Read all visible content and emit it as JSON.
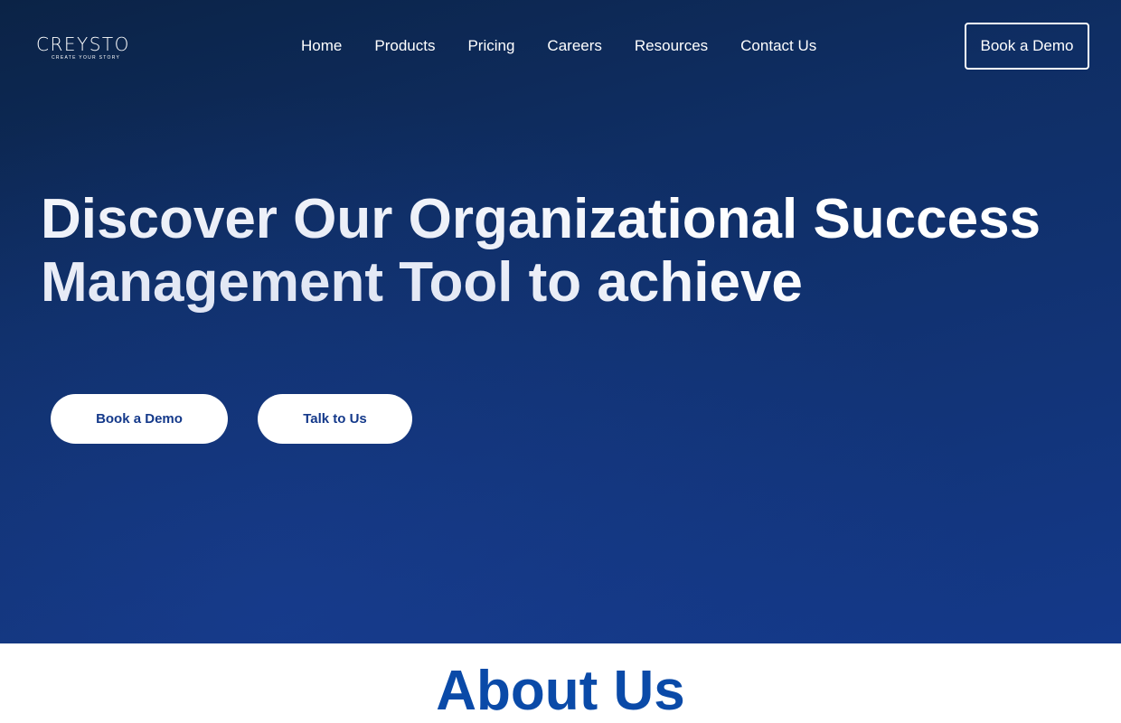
{
  "brand": {
    "name": "CREYSTO",
    "tagline": "CREATE YOUR STORY"
  },
  "nav": {
    "items": [
      {
        "label": "Home"
      },
      {
        "label": "Products"
      },
      {
        "label": "Pricing"
      },
      {
        "label": "Careers"
      },
      {
        "label": "Resources"
      },
      {
        "label": "Contact Us"
      }
    ],
    "cta_label": "Book a Demo"
  },
  "hero": {
    "headline": "Discover Our Organizational Success Management Tool to achieve",
    "primary_button": "Book a Demo",
    "secondary_button": "Talk to Us"
  },
  "about": {
    "title": "About Us"
  },
  "colors": {
    "hero_start": "#0b2346",
    "hero_end": "#14398a",
    "accent_text": "#14398a",
    "about_title": "#0a4aa8"
  }
}
